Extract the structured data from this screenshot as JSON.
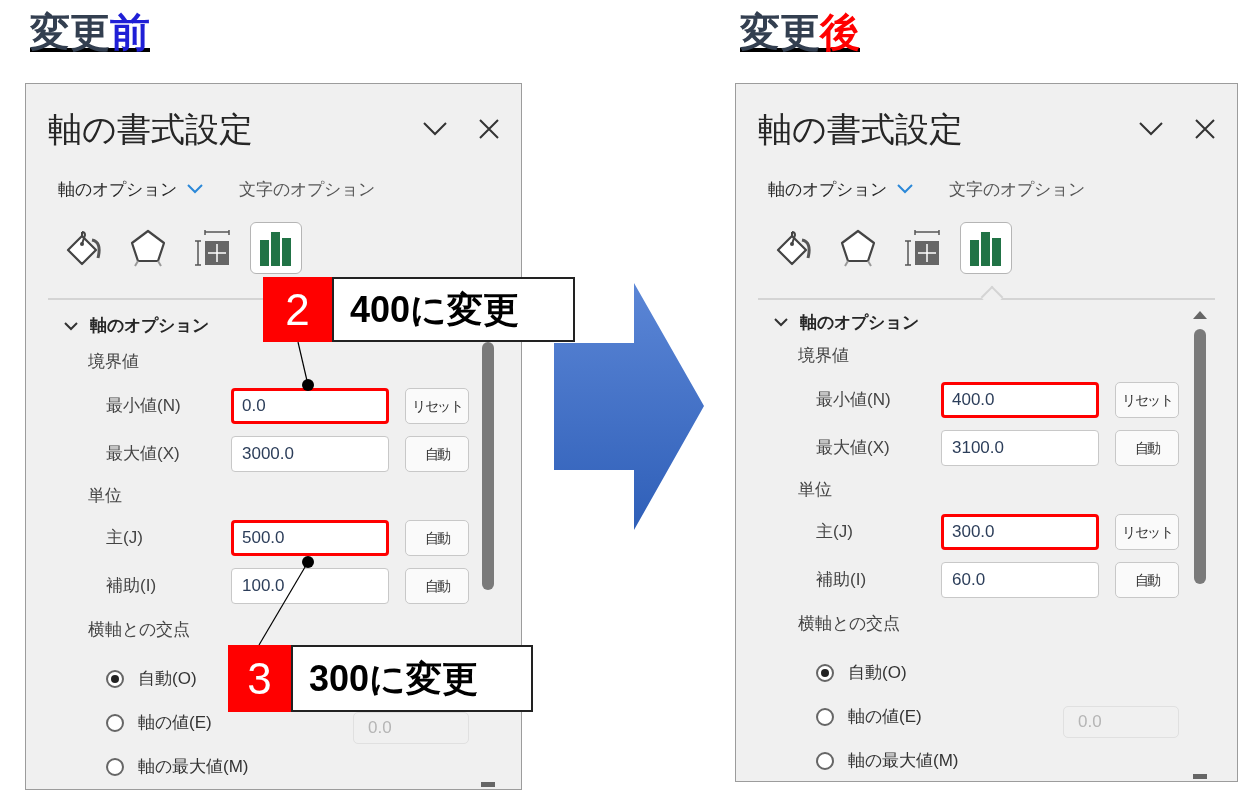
{
  "comparisons": [
    {
      "heading": {
        "parts": [
          {
            "text": "変更",
            "color": "#333f50"
          },
          {
            "text": "前",
            "color": "#1f1fd6"
          }
        ]
      },
      "panel": {
        "title": "軸の書式設定",
        "option_tabs": [
          {
            "label": "軸のオプション",
            "selected": true,
            "has_dropdown": true
          },
          {
            "label": "文字のオプション",
            "selected": false,
            "has_dropdown": false
          }
        ],
        "icon_tabs": [
          {
            "kind": "fill",
            "selected": false
          },
          {
            "kind": "effects",
            "selected": false
          },
          {
            "kind": "size",
            "selected": false
          },
          {
            "kind": "axis",
            "selected": true
          }
        ],
        "section": {
          "title": "軸のオプション",
          "expanded": true,
          "groups": [
            {
              "title": "境界値",
              "rows": [
                {
                  "label": "最小値(N)",
                  "value": "0.0",
                  "button": "リセット",
                  "highlighted": true
                },
                {
                  "label": "最大値(X)",
                  "value": "3000.0",
                  "button": "自動",
                  "highlighted": false
                }
              ]
            },
            {
              "title": "単位",
              "rows": [
                {
                  "label": "主(J)",
                  "value": "500.0",
                  "button": "自動",
                  "highlighted": true
                },
                {
                  "label": "補助(I)",
                  "value": "100.0",
                  "button": "自動",
                  "highlighted": false
                }
              ]
            },
            {
              "title": "横軸との交点",
              "options": [
                {
                  "label": "自動(O)",
                  "selected": true
                },
                {
                  "label": "軸の値(E)",
                  "selected": false,
                  "field_value": "0.0",
                  "field_disabled": true
                },
                {
                  "label": "軸の最大値(M)",
                  "selected": false
                }
              ]
            }
          ]
        }
      },
      "callouts": [
        {
          "number": "2",
          "text": "400に変更"
        },
        {
          "number": "3",
          "text": "300に変更"
        }
      ]
    },
    {
      "heading": {
        "parts": [
          {
            "text": "変更",
            "color": "#333f50"
          },
          {
            "text": "後",
            "color": "#ff0000"
          }
        ]
      },
      "panel": {
        "title": "軸の書式設定",
        "option_tabs": [
          {
            "label": "軸のオプション",
            "selected": true,
            "has_dropdown": true
          },
          {
            "label": "文字のオプション",
            "selected": false,
            "has_dropdown": false
          }
        ],
        "icon_tabs": [
          {
            "kind": "fill",
            "selected": false
          },
          {
            "kind": "effects",
            "selected": false
          },
          {
            "kind": "size",
            "selected": false
          },
          {
            "kind": "axis",
            "selected": true
          }
        ],
        "section": {
          "title": "軸のオプション",
          "expanded": true,
          "groups": [
            {
              "title": "境界値",
              "rows": [
                {
                  "label": "最小値(N)",
                  "value": "400.0",
                  "button": "リセット",
                  "highlighted": true
                },
                {
                  "label": "最大値(X)",
                  "value": "3100.0",
                  "button": "自動",
                  "highlighted": false
                }
              ]
            },
            {
              "title": "単位",
              "rows": [
                {
                  "label": "主(J)",
                  "value": "300.0",
                  "button": "リセット",
                  "highlighted": true
                },
                {
                  "label": "補助(I)",
                  "value": "60.0",
                  "button": "自動",
                  "highlighted": false
                }
              ]
            },
            {
              "title": "横軸との交点",
              "options": [
                {
                  "label": "自動(O)",
                  "selected": true
                },
                {
                  "label": "軸の値(E)",
                  "selected": false,
                  "field_value": "0.0",
                  "field_disabled": true
                },
                {
                  "label": "軸の最大値(M)",
                  "selected": false
                }
              ]
            }
          ]
        }
      }
    }
  ]
}
